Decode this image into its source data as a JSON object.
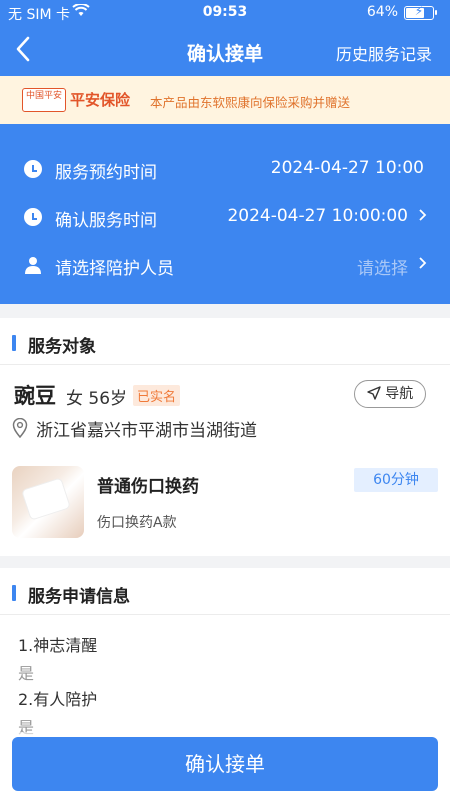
{
  "status_bar": {
    "carrier": "无 SIM 卡",
    "time": "09:53",
    "battery_percent": "64%",
    "battery_level": 0.64
  },
  "nav": {
    "back_icon": "chevron-left-icon",
    "title": "确认接单",
    "history_link": "历史服务记录"
  },
  "banner": {
    "logo_small": "中国平安",
    "logo_name": "平安保险",
    "text": "本产品由东软熙康向保险采购并赠送"
  },
  "times": {
    "appointment_label": "服务预约时间",
    "appointment_value": "2024-04-27 10:00",
    "confirm_label": "确认服务时间",
    "confirm_value": "2024-04-27 10:00:00",
    "escort_label": "请选择陪护人员",
    "escort_placeholder": "请选择"
  },
  "service_target": {
    "section_title": "服务对象",
    "name": "豌豆",
    "gender_age": "女 56岁",
    "verified_badge": "已实名",
    "navigate_button": "导航",
    "address": "浙江省嘉兴市平湖市当湖街道",
    "service": {
      "name": "普通伤口换药",
      "sub": "伤口换药A款",
      "duration": "60分钟"
    }
  },
  "application": {
    "section_title": "服务申请信息",
    "items": [
      {
        "q": "1.神志清醒",
        "a": "是"
      },
      {
        "q": "2.有人陪护",
        "a": "是"
      }
    ]
  },
  "footer": {
    "confirm_button": "确认接单"
  },
  "colors": {
    "primary": "#3d86f0",
    "banner_bg": "#fff4e0",
    "brand_orange": "#e2552a",
    "verified": "#f07a39"
  }
}
